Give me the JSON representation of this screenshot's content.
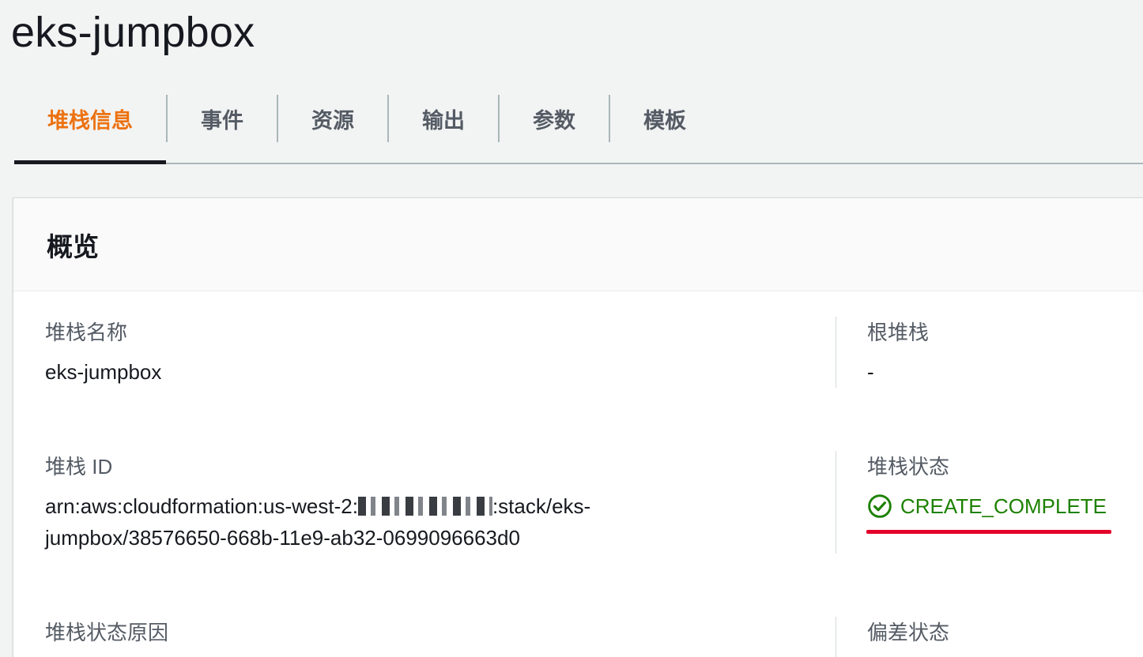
{
  "page": {
    "title": "eks-jumpbox"
  },
  "tabs": [
    {
      "label": "堆栈信息",
      "active": true
    },
    {
      "label": "事件",
      "active": false
    },
    {
      "label": "资源",
      "active": false
    },
    {
      "label": "输出",
      "active": false
    },
    {
      "label": "参数",
      "active": false
    },
    {
      "label": "模板",
      "active": false
    }
  ],
  "overview": {
    "title": "概览",
    "stack_name": {
      "label": "堆栈名称",
      "value": "eks-jumpbox"
    },
    "root_stack": {
      "label": "根堆栈",
      "value": "-"
    },
    "stack_id": {
      "label": "堆栈 ID",
      "value_prefix": "arn:aws:cloudformation:us-west-2:",
      "value_suffix": ":stack/eks-jumpbox/38576650-668b-11e9-ab32-0699096663d0"
    },
    "stack_status": {
      "label": "堆栈状态",
      "value": "CREATE_COMPLETE"
    },
    "stack_status_reason": {
      "label": "堆栈状态原因"
    },
    "drift_status": {
      "label": "偏差状态"
    }
  },
  "colors": {
    "active_tab": "#ec7211",
    "status_success": "#1d8102",
    "annotation_red": "#e4002b"
  },
  "icons": {
    "status": "check-circle-icon"
  }
}
